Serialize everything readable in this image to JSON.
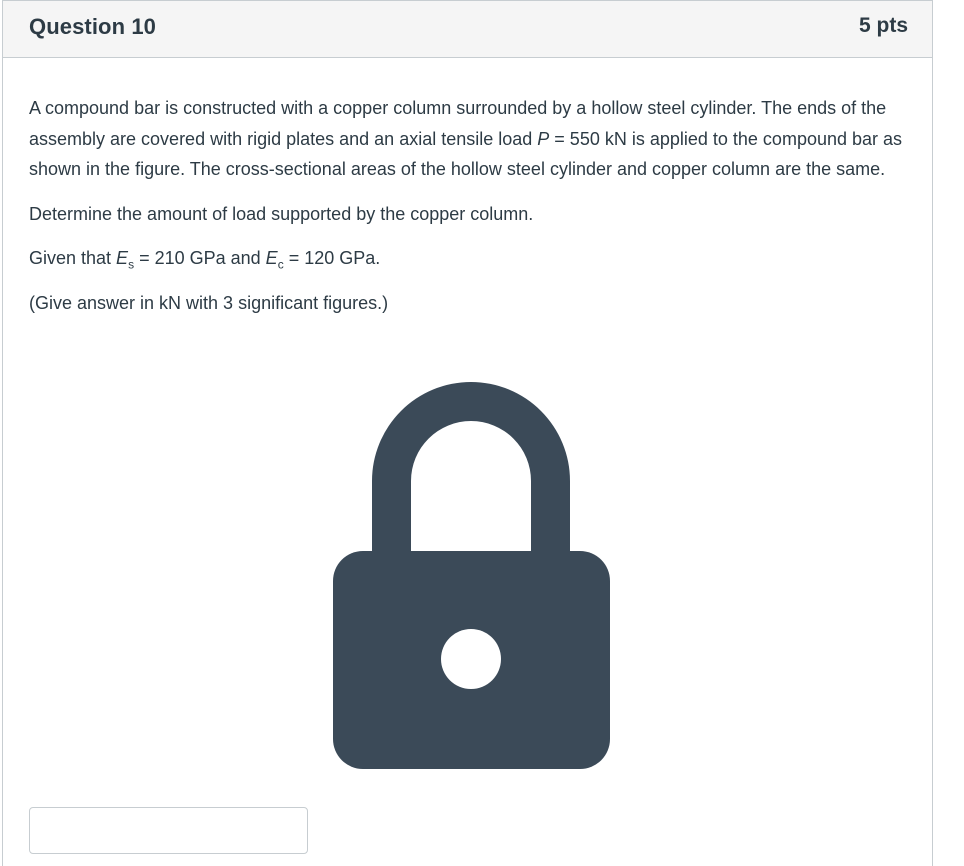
{
  "question": {
    "title": "Question 10",
    "points": "5 pts"
  },
  "body": {
    "paragraph1_part1": "A compound bar is constructed with a copper column surrounded by a hollow steel cylinder. The ends of the assembly are covered with rigid plates and an axial tensile load ",
    "paragraph1_var": "P",
    "paragraph1_part2": " = 550 kN is applied to the compound bar as shown in the figure. The cross-sectional areas of the hollow steel cylinder and copper column are the same.",
    "paragraph2": "Determine the amount of load supported by the copper column.",
    "given_prefix": "Given that ",
    "given_es_var": "E",
    "given_es_sub": "s",
    "given_es_value": " = 210 GPa and ",
    "given_ec_var": "E",
    "given_ec_sub": "c",
    "given_ec_value": " = 120 GPa.",
    "note": "(Give answer in kN with 3 significant figures.)"
  },
  "figure": {
    "icon": "lock-icon",
    "color": "#3b4a58"
  },
  "answer": {
    "value": "",
    "placeholder": ""
  }
}
